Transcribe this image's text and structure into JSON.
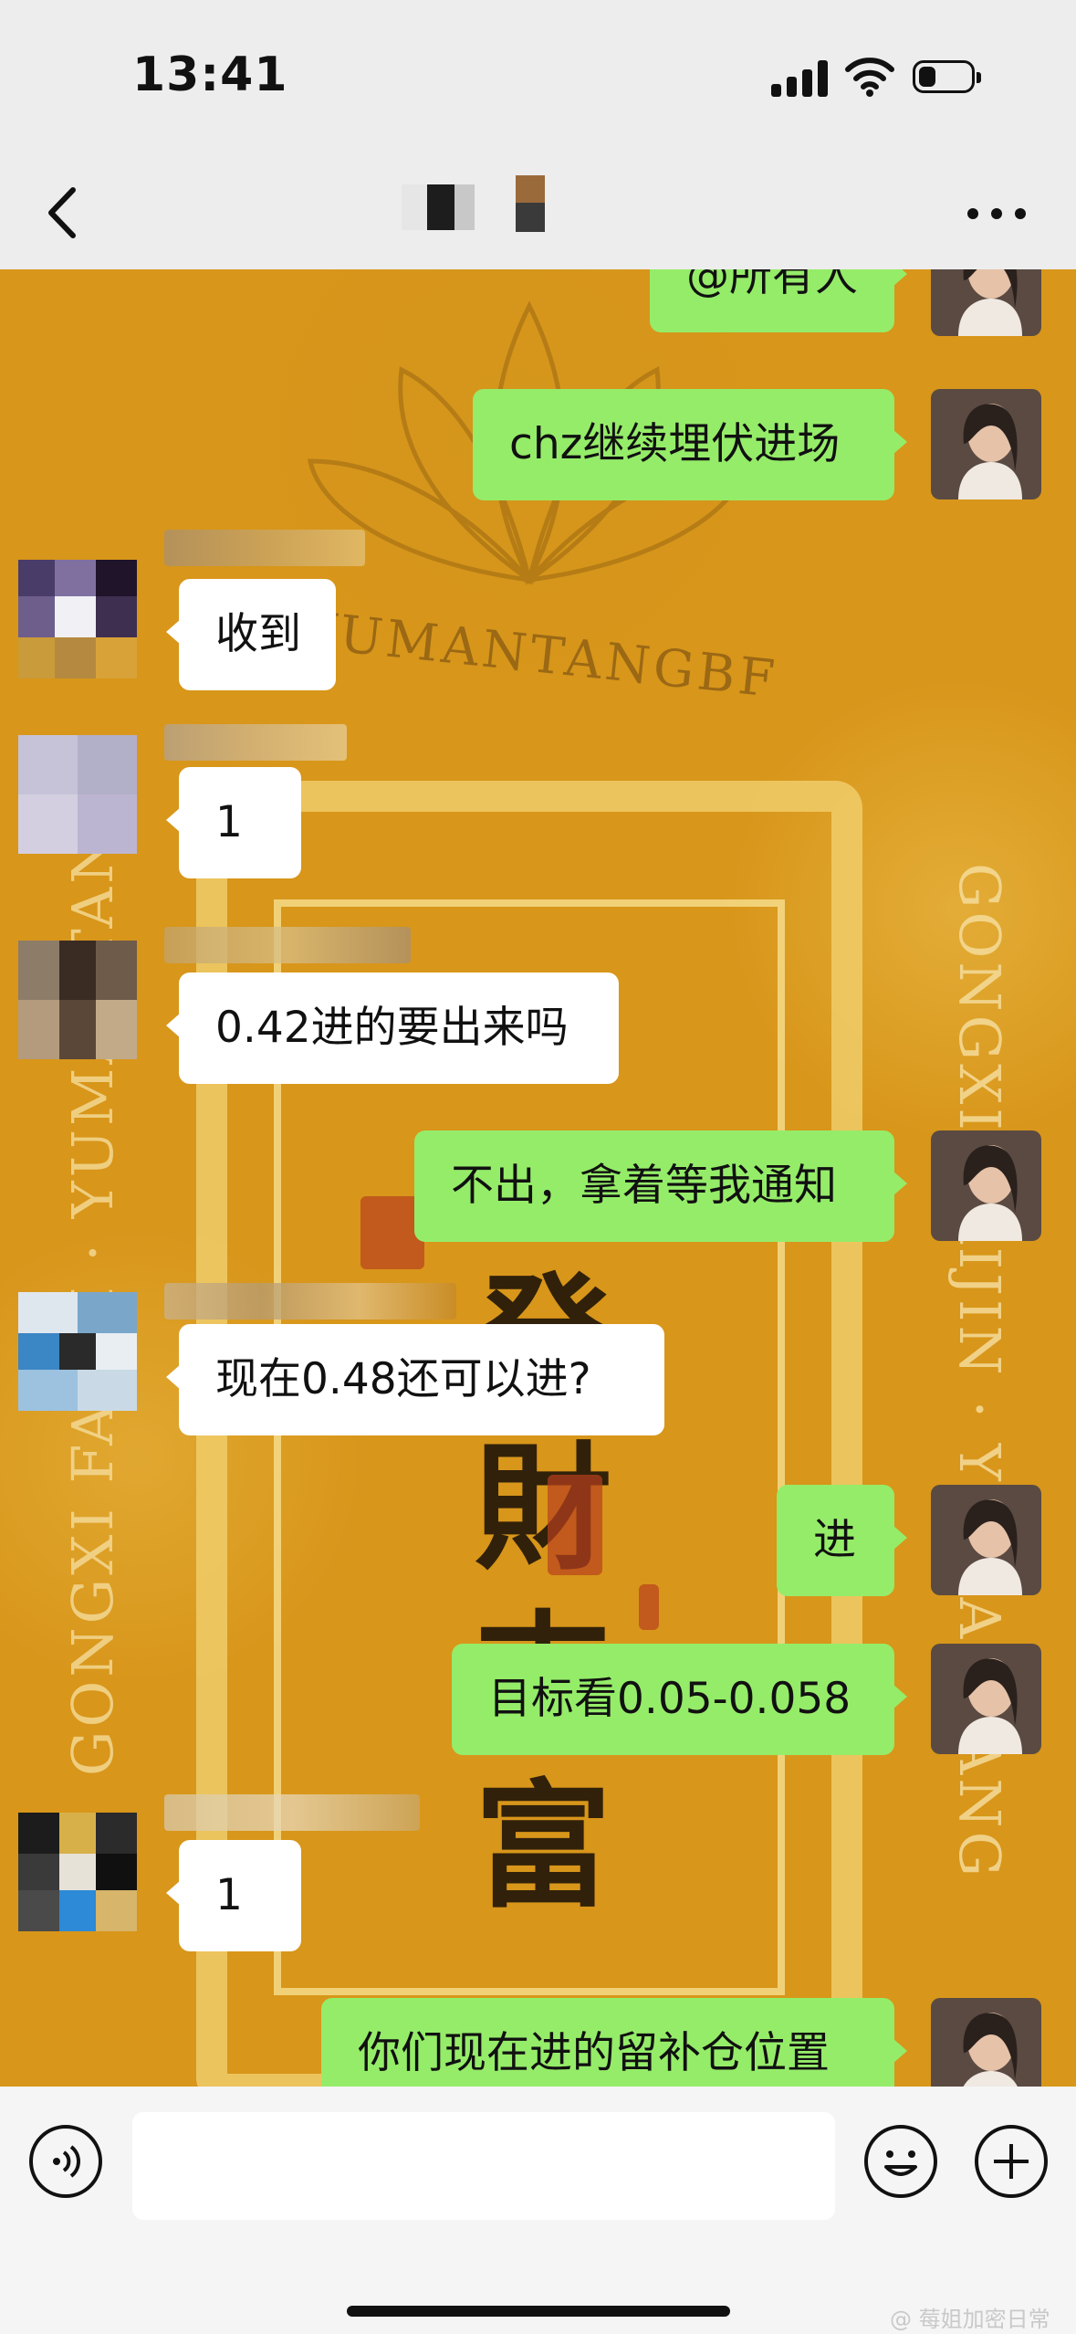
{
  "status_bar": {
    "time": "13:41"
  },
  "header": {
    "icons": [
      "chevron-left-icon",
      "more-icon"
    ]
  },
  "chat": {
    "watermark_arc": "YUMANTANGBF",
    "watermark_right": "GONGXI CAIJIN · YUMANTANG",
    "watermark_left": "GONGXI FACAI · YUMANTANG",
    "calligraphy": "発財吉富",
    "messages": [
      {
        "side": "me",
        "text": "@所有人"
      },
      {
        "side": "me",
        "text": "chz继续埋伏进场"
      },
      {
        "side": "other",
        "text": "收到"
      },
      {
        "side": "other",
        "text": "1"
      },
      {
        "side": "other",
        "text": "0.42进的要出来吗"
      },
      {
        "side": "me",
        "text": "不出，拿着等我通知"
      },
      {
        "side": "other",
        "text": "现在0.48还可以进?"
      },
      {
        "side": "me",
        "text": "进"
      },
      {
        "side": "me",
        "text": "目标看0.05-0.058"
      },
      {
        "side": "other",
        "text": "1"
      },
      {
        "side": "me",
        "text": "你们现在进的留补仓位置"
      }
    ]
  },
  "input_bar": {
    "text_value": "",
    "icons": [
      "voice-icon",
      "emoji-icon",
      "plus-icon"
    ]
  },
  "credit": "@ 莓姐加密日常"
}
